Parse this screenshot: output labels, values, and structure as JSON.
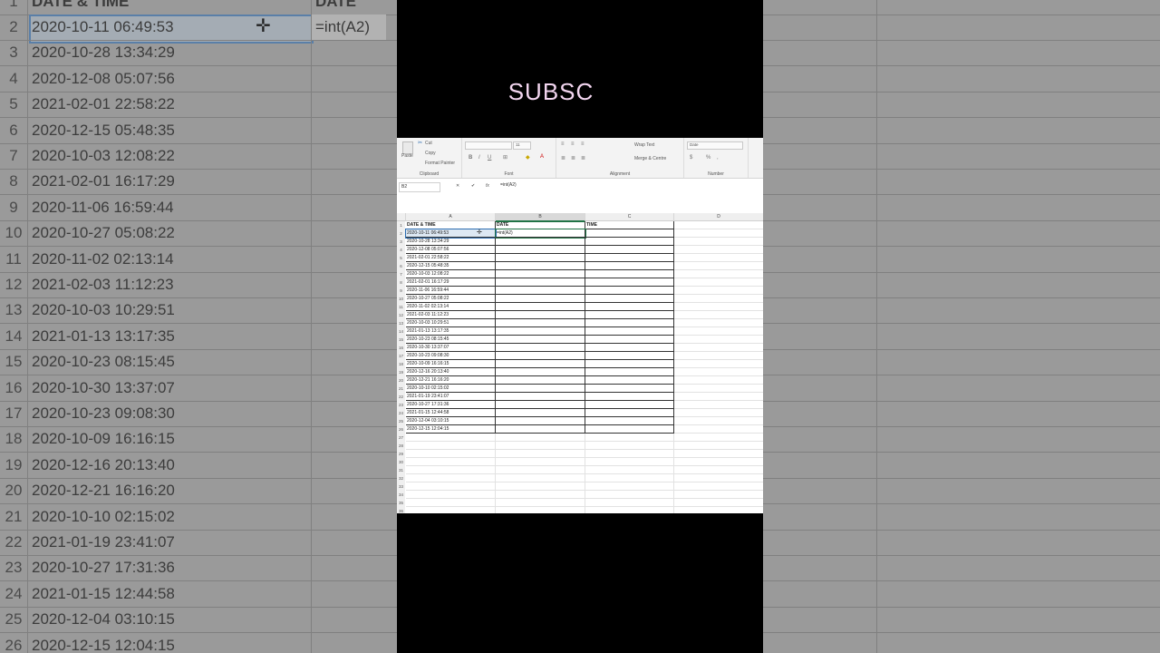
{
  "background": {
    "header_a": "DATE & TIME",
    "header_b": "DATE",
    "formula_text": "=int(A2)",
    "rows": [
      {
        "n": "2",
        "v": "2020-10-11 06:49:53"
      },
      {
        "n": "3",
        "v": "2020-10-28 13:34:29"
      },
      {
        "n": "4",
        "v": "2020-12-08 05:07:56"
      },
      {
        "n": "5",
        "v": "2021-02-01 22:58:22"
      },
      {
        "n": "6",
        "v": "2020-12-15 05:48:35"
      },
      {
        "n": "7",
        "v": "2020-10-03 12:08:22"
      },
      {
        "n": "8",
        "v": "2021-02-01 16:17:29"
      },
      {
        "n": "9",
        "v": "2020-11-06 16:59:44"
      },
      {
        "n": "10",
        "v": "2020-10-27 05:08:22"
      },
      {
        "n": "11",
        "v": "2020-11-02 02:13:14"
      },
      {
        "n": "12",
        "v": "2021-02-03 11:12:23"
      },
      {
        "n": "13",
        "v": "2020-10-03 10:29:51"
      },
      {
        "n": "14",
        "v": "2021-01-13 13:17:35"
      },
      {
        "n": "15",
        "v": "2020-10-23 08:15:45"
      },
      {
        "n": "16",
        "v": "2020-10-30 13:37:07"
      },
      {
        "n": "17",
        "v": "2020-10-23 09:08:30"
      },
      {
        "n": "18",
        "v": "2020-10-09 16:16:15"
      },
      {
        "n": "19",
        "v": "2020-12-16 20:13:40"
      },
      {
        "n": "20",
        "v": "2020-12-21 16:16:20"
      },
      {
        "n": "21",
        "v": "2020-10-10 02:15:02"
      },
      {
        "n": "22",
        "v": "2021-01-19 23:41:07"
      },
      {
        "n": "23",
        "v": "2020-10-27 17:31:36"
      },
      {
        "n": "24",
        "v": "2021-01-15 12:44:58"
      },
      {
        "n": "25",
        "v": "2020-12-04 03:10:15"
      },
      {
        "n": "26",
        "v": "2020-12-15 12:04:15"
      }
    ]
  },
  "overlay": {
    "subscribe_text": "SUBSC"
  },
  "ribbon": {
    "clipboard": {
      "label": "Clipboard",
      "paste": "Paste",
      "cut": "Cut",
      "copy": "Copy",
      "format_painter": "Format Painter"
    },
    "font": {
      "label": "Font",
      "size": "11",
      "bold": "B",
      "italic": "I",
      "underline": "U"
    },
    "alignment": {
      "label": "Alignment",
      "wrap": "Wrap Text",
      "merge": "Merge & Centre"
    },
    "number": {
      "label": "Number",
      "format": "Date",
      "currency": "$",
      "percent": "%",
      "comma": ","
    }
  },
  "formula_bar": {
    "name_box": "B2",
    "cancel": "✕",
    "enter": "✔",
    "fx": "fx",
    "formula": "=int(A2)"
  },
  "sheet": {
    "columns": [
      "A",
      "B",
      "C",
      "D"
    ],
    "headers": {
      "a": "DATE & TIME",
      "b": "DATE",
      "c": "TIME"
    },
    "editing_value": "=int(A2)",
    "rows": [
      "2020-10-11 06:49:53",
      "2020-10-28 13:34:29",
      "2020-12-08 05:07:56",
      "2021-02-01 22:58:22",
      "2020-12-15 05:48:35",
      "2020-10-03 12:08:22",
      "2021-02-01 16:17:29",
      "2020-11-06 16:59:44",
      "2020-10-27 05:08:22",
      "2020-11-02 02:13:14",
      "2021-02-03 11:12:23",
      "2020-10-03 10:29:51",
      "2021-01-13 13:17:35",
      "2020-10-23 08:15:45",
      "2020-10-30 13:37:07",
      "2020-10-23 09:08:30",
      "2020-10-09 16:16:15",
      "2020-12-16 20:13:40",
      "2020-12-21 16:16:20",
      "2020-10-10 02:15:02",
      "2021-01-19 23:41:07",
      "2020-10-27 17:31:36",
      "2021-01-15 12:44:58",
      "2020-12-04 03:10:15",
      "2020-12-15 12:04:15"
    ],
    "empty_row_numbers": [
      "27",
      "28",
      "29",
      "30",
      "31",
      "32",
      "33",
      "34",
      "35",
      "36"
    ]
  }
}
